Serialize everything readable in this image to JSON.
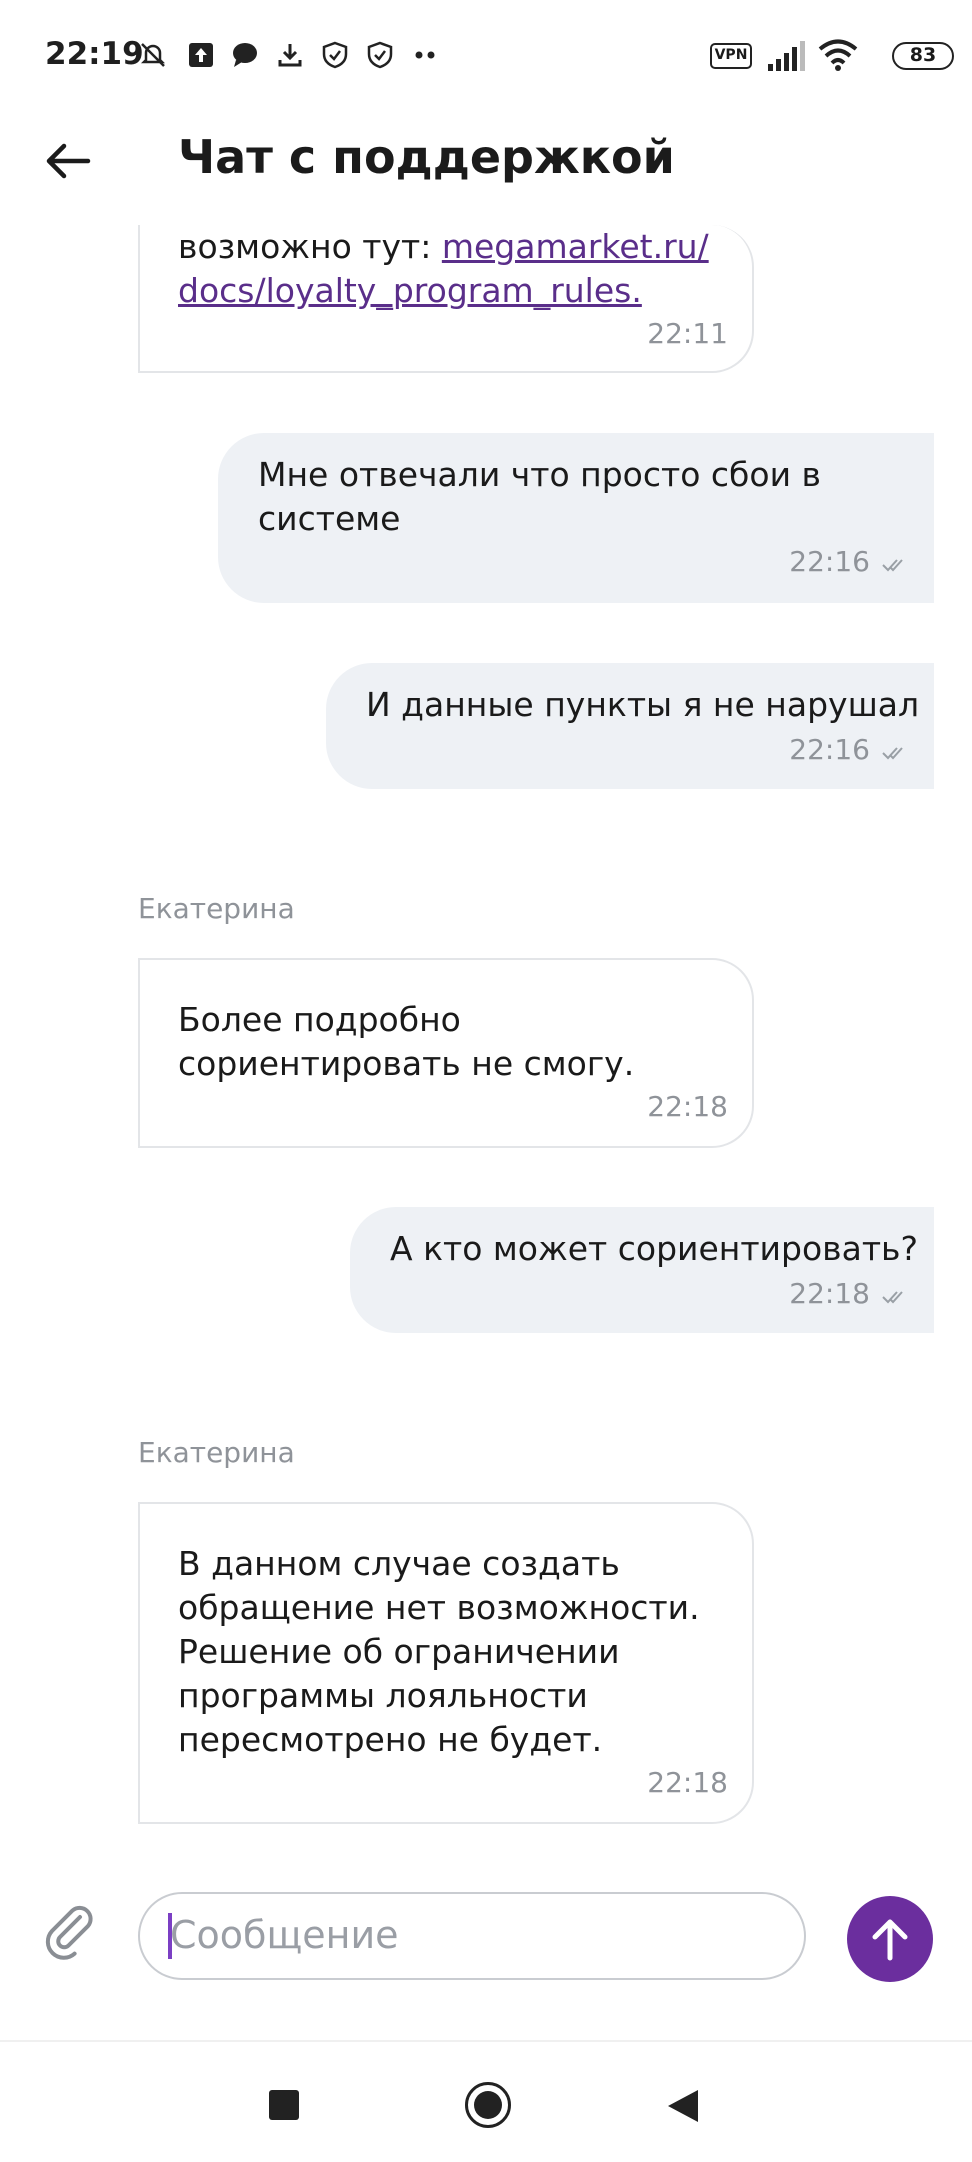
{
  "status_bar": {
    "time": "22:19",
    "vpn": "VPN",
    "battery": "83",
    "icons": [
      "muted-bell-icon",
      "upload-icon",
      "chat-bubble-icon",
      "download-icon",
      "shield-check-icon",
      "shield-check-icon",
      "more-dots-icon",
      "signal-icon",
      "wifi-icon"
    ]
  },
  "header": {
    "title": "Чат с поддержкой"
  },
  "messages": [
    {
      "direction": "in",
      "text_prefix": "возможно тут: ",
      "link_line1": "megamarket.ru/",
      "link_line2": "docs/loyalty_program_rules.",
      "time": "22:11"
    },
    {
      "direction": "out",
      "line1": "Мне отвечали что просто сбои в",
      "line2": "системе",
      "time": "22:16"
    },
    {
      "direction": "out",
      "line1": "И данные пункты я не нарушал",
      "time": "22:16"
    },
    {
      "direction": "in",
      "sender": "Екатерина",
      "line1": "Более подробно",
      "line2": "сориентировать не смогу.",
      "time": "22:18"
    },
    {
      "direction": "out",
      "line1": "А кто может сориентировать?",
      "time": "22:18"
    },
    {
      "direction": "in",
      "sender": "Екатерина",
      "lines": [
        "В данном случае создать",
        "обращение нет возможности.",
        "Решение об ограничении",
        "программы лояльности",
        "пересмотрено не будет."
      ],
      "time": "22:18"
    }
  ],
  "composer": {
    "placeholder": "Сообщение"
  },
  "colors": {
    "accent": "#6b2e9e",
    "outgoing_bubble": "#eef1f5",
    "link": "#5a2e8a"
  }
}
